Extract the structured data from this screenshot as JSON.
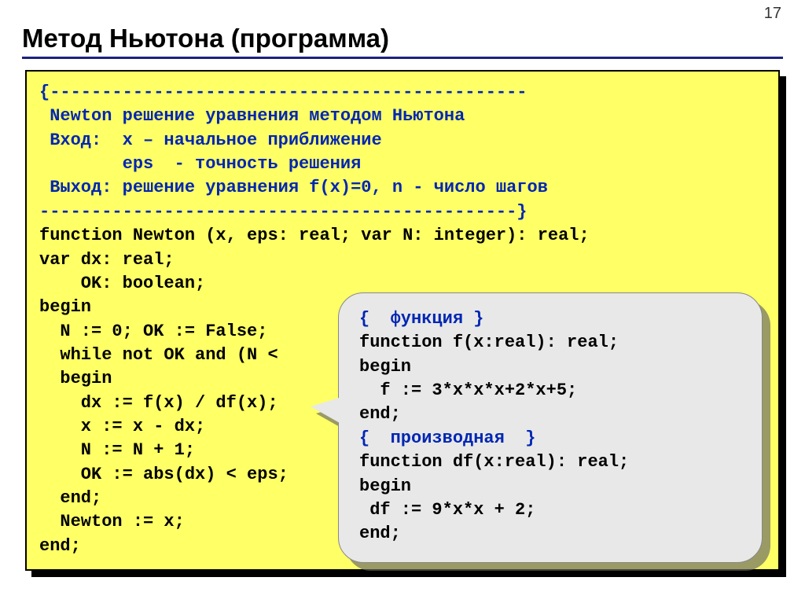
{
  "page_number": "17",
  "title": "Метод Ньютона (программа)",
  "code": {
    "l01": "{----------------------------------------------",
    "l02": " Newton решение уравнения методом Ньютона",
    "l03": " Вход:  x – начальное приближение",
    "l04": "        eps  - точность решения",
    "l05": " Выход: решение уравнения f(x)=0, n - число шагов",
    "l06": "----------------------------------------------}",
    "l07": "function Newton (x, eps: real; var N: integer): real;",
    "l08": "var dx: real;",
    "l09": "    OK: boolean;",
    "l10": "begin",
    "l11": "  N := 0; OK := False;",
    "l12": "  while not OK and (N <",
    "l13": "  begin",
    "l14": "    dx := f(x) / df(x);",
    "l15": "    x := x - dx;",
    "l16": "    N := N + 1;",
    "l17": "    OK := abs(dx) < eps;",
    "l18": "  end;",
    "l19": "  Newton := x;",
    "l20": "end;"
  },
  "callout": {
    "c01": "{  функция }",
    "c02": "function f(x:real): real;",
    "c03": "begin",
    "c04": "  f := 3*x*x*x+2*x+5;",
    "c05": "end;",
    "c06": "{  производная  }",
    "c07": "function df(x:real): real;",
    "c08": "begin",
    "c09": " df := 9*x*x + 2;",
    "c10": "end;"
  }
}
